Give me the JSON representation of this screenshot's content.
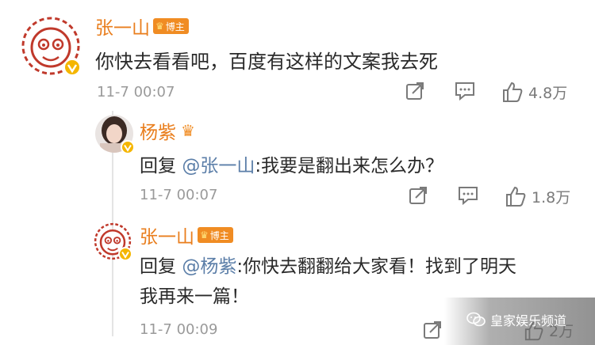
{
  "comments": [
    {
      "user": "张一山",
      "badge": "博主",
      "text": "你快去看看吧，百度有这样的文案我去死",
      "time": "11-7 00:07",
      "likes": "4.8万"
    },
    {
      "user": "杨紫",
      "reply_prefix": "回复",
      "mention": "@张一山",
      "text": ":我要是翻出来怎么办？",
      "time": "11-7 00:07",
      "likes": "1.8万"
    },
    {
      "user": "张一山",
      "badge": "博主",
      "reply_prefix": "回复",
      "mention": "@杨紫",
      "text_line1": ":你快去翻翻给大家看！找到了明天",
      "text_line2": "我再来一篇！",
      "time": "11-7 00:09",
      "likes": "2万"
    }
  ],
  "watermark": "皇家娱乐频道",
  "colors": {
    "name": "#e97e1d",
    "mention": "#5b7ea8",
    "badge": "#f08c23",
    "timestamp": "#9a9a9a"
  },
  "icons": [
    "monkey-avatar",
    "verified-v-icon",
    "crown-icon",
    "share-icon",
    "comment-icon",
    "like-icon",
    "wechat-icon"
  ]
}
